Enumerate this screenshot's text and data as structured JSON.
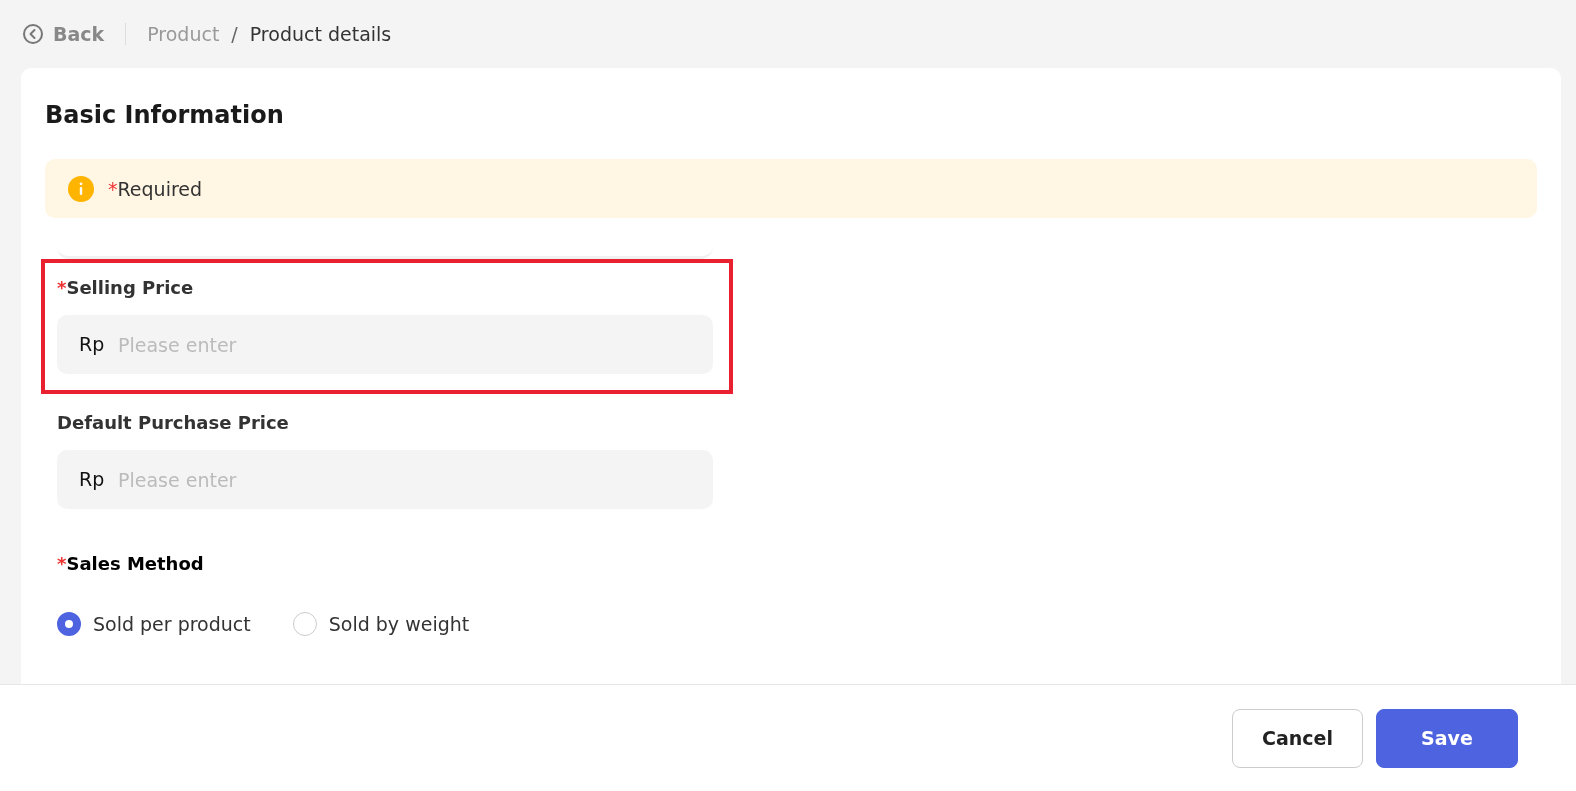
{
  "header": {
    "back": "Back",
    "separator": "/",
    "breadcrumbs": [
      {
        "label": "Product",
        "current": false
      },
      {
        "label": "Product details",
        "current": true
      }
    ]
  },
  "section": {
    "title": "Basic Information",
    "notice": {
      "mark": "*",
      "text": "Required"
    }
  },
  "fields": [
    {
      "kind": "price",
      "mark": "*",
      "label": "Selling Price",
      "prefix": "Rp",
      "placeholder": "Please enter",
      "highlighted": true
    },
    {
      "kind": "price",
      "label": "Default Purchase Price",
      "prefix": "Rp",
      "placeholder": "Please enter",
      "highlighted": false
    },
    {
      "kind": "radio",
      "mark": "*",
      "label": "Sales Method",
      "options": [
        {
          "label": "Sold per product",
          "selected": true
        },
        {
          "label": "Sold by weight",
          "selected": false
        }
      ]
    }
  ],
  "footer": {
    "buttons": [
      {
        "label": "Cancel",
        "kind": "secondary"
      },
      {
        "label": "Save",
        "kind": "primary"
      }
    ]
  }
}
